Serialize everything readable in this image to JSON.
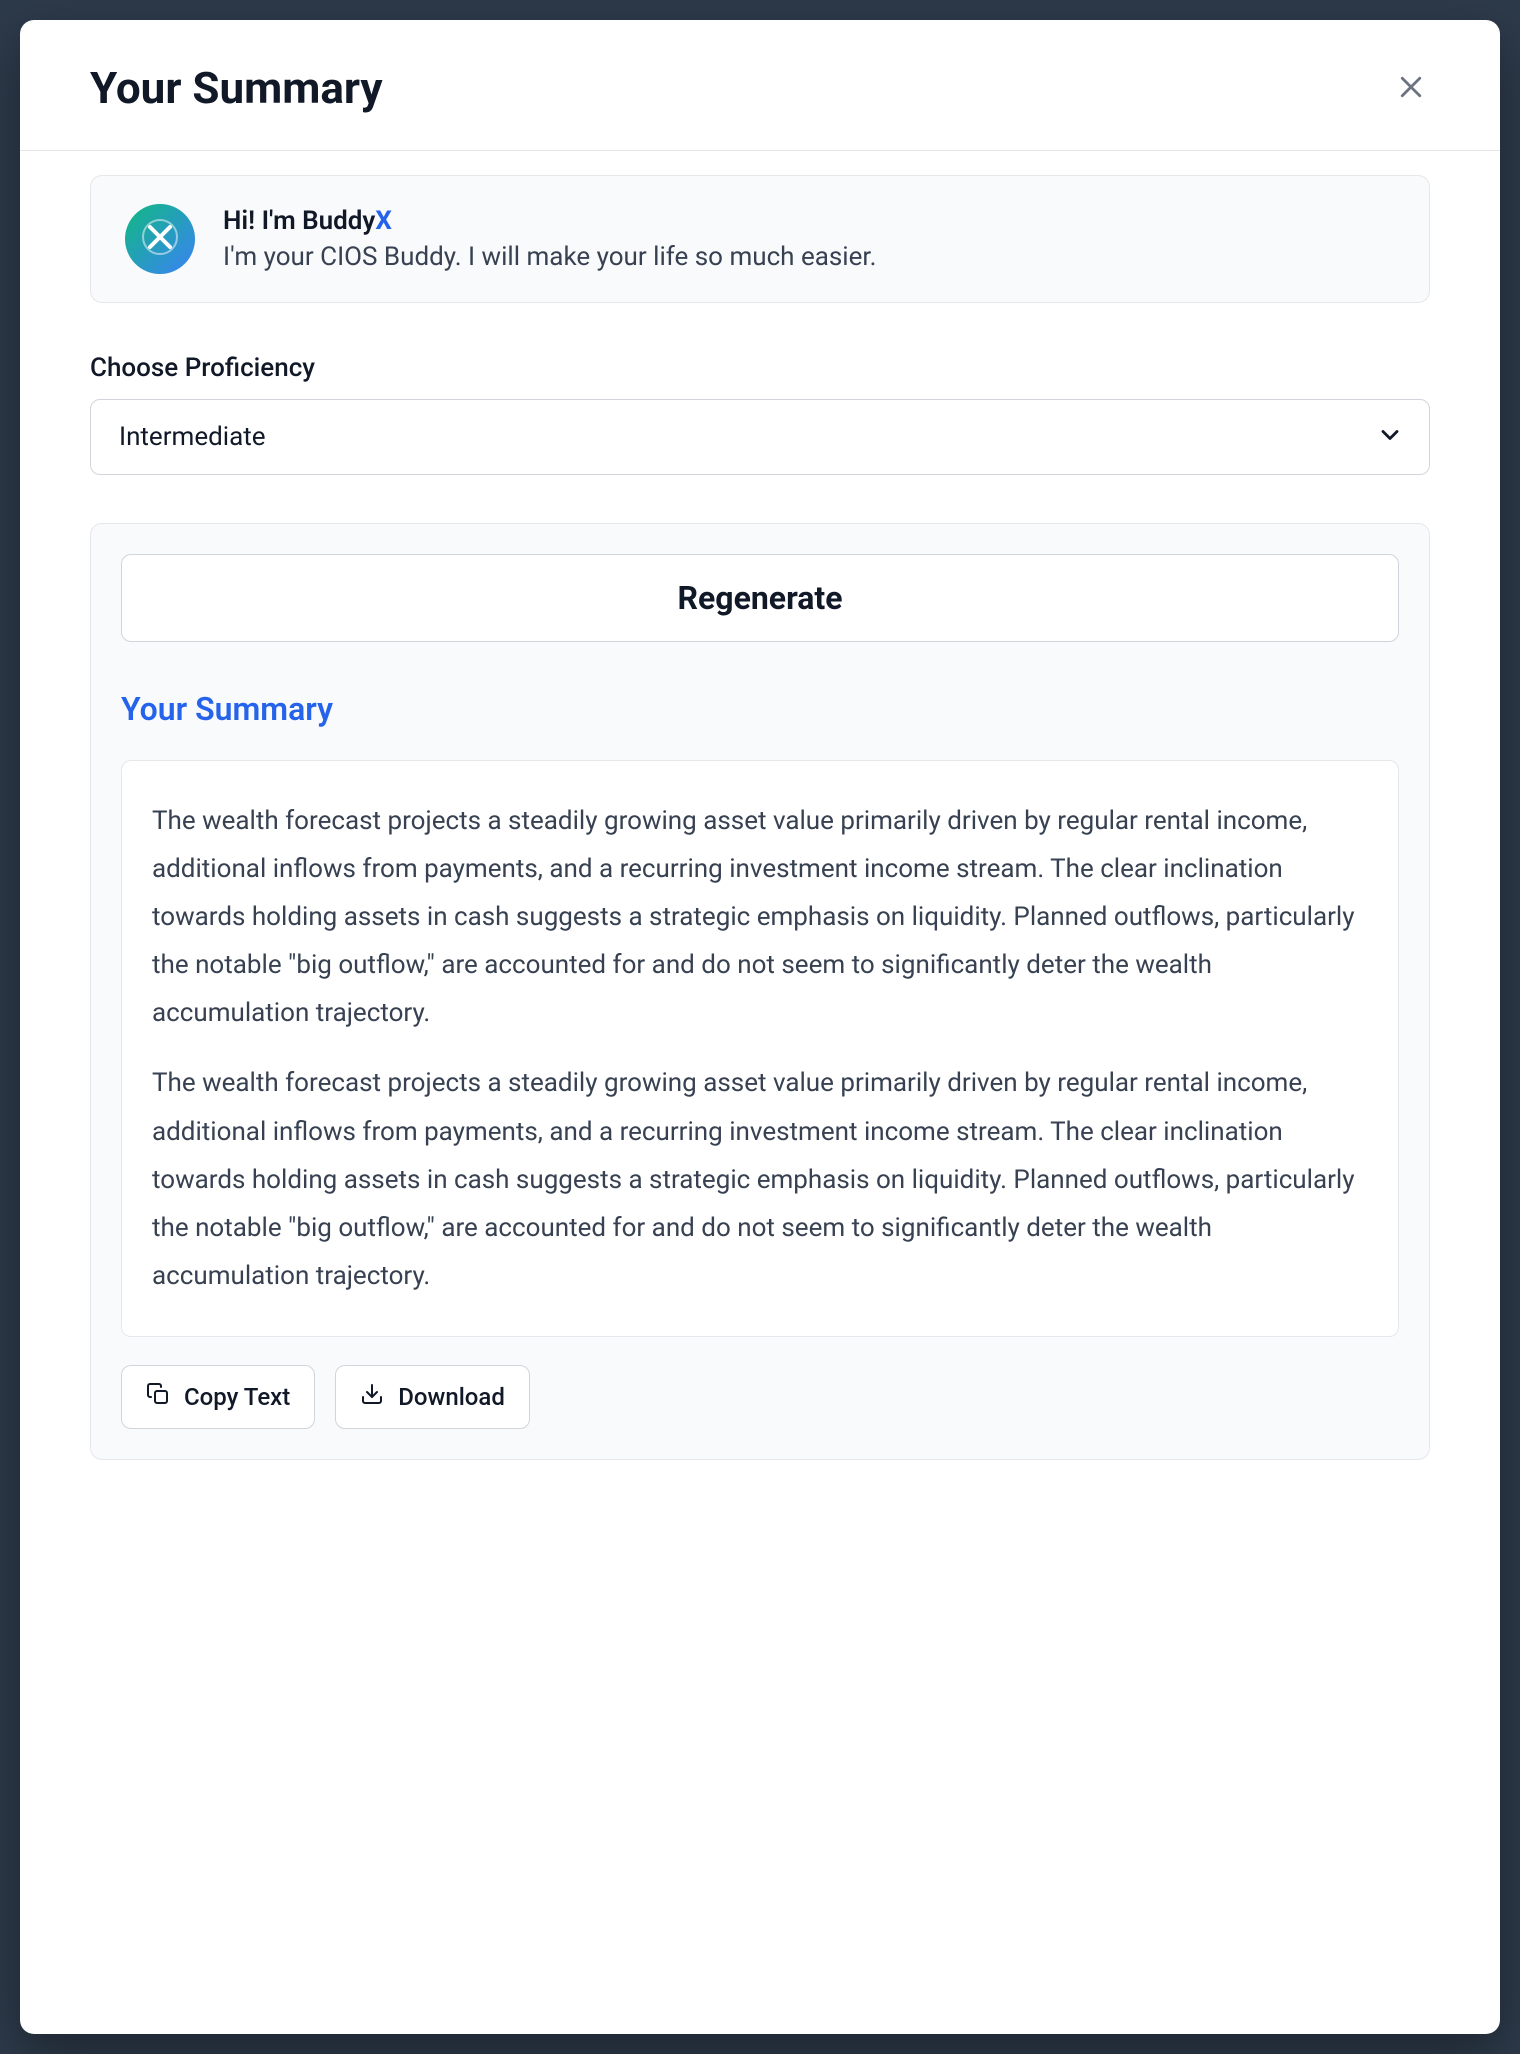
{
  "header": {
    "title": "Your Summary"
  },
  "intro": {
    "greeting_prefix": "Hi! I'm Buddy",
    "greeting_accent": "X",
    "subtitle": "I'm your CIOS Buddy. I will make your life so much easier."
  },
  "proficiency": {
    "label": "Choose Proficiency",
    "selected": "Intermediate"
  },
  "summary": {
    "regenerate_label": "Regenerate",
    "heading": "Your Summary",
    "paragraphs": [
      "The wealth forecast projects a steadily growing asset value primarily driven by regular rental income, additional inflows from payments, and a recurring investment income stream. The clear inclination towards holding assets in cash suggests a strategic emphasis on liquidity. Planned outflows, particularly the notable \"big outflow,\" are accounted for and do not seem to significantly deter the wealth accumulation trajectory.",
      "The wealth forecast projects a steadily growing asset value primarily driven by regular rental income, additional inflows from payments, and a recurring investment income stream. The clear inclination towards holding assets in cash suggests a strategic emphasis on liquidity. Planned outflows, particularly the notable \"big outflow,\" are accounted for and do not seem to significantly deter the wealth accumulation trajectory."
    ],
    "actions": {
      "copy_label": "Copy Text",
      "download_label": "Download"
    }
  }
}
